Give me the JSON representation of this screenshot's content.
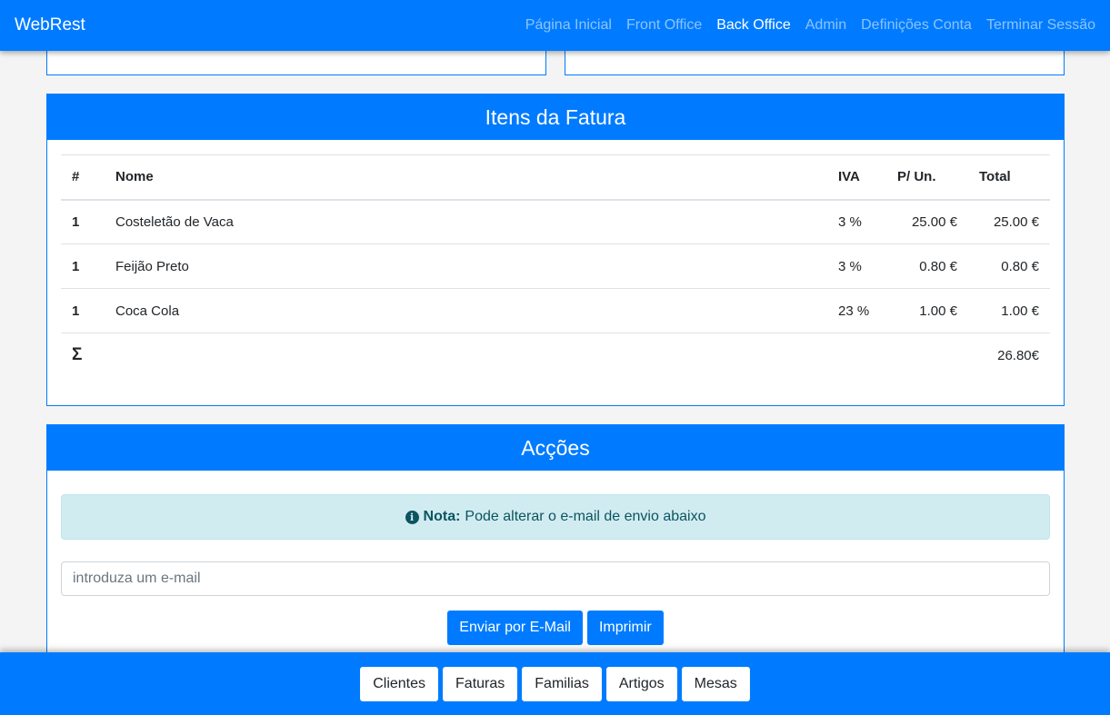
{
  "navbar": {
    "brand": "WebRest",
    "links": [
      {
        "label": "Página Inicial"
      },
      {
        "label": "Front Office"
      },
      {
        "label": "Back Office"
      },
      {
        "label": "Admin"
      },
      {
        "label": "Definições Conta"
      },
      {
        "label": "Terminar Sessão"
      }
    ],
    "active_link": "Back Office"
  },
  "items_card": {
    "title": "Itens da Fatura",
    "headers": {
      "num": "#",
      "name": "Nome",
      "iva": "IVA",
      "unit_price": "P/ Un.",
      "total": "Total"
    },
    "rows": [
      {
        "qty": "1",
        "name": "Costeletão de Vaca",
        "iva": "3 %",
        "unit_price": "25.00 €",
        "total": "25.00 €"
      },
      {
        "qty": "1",
        "name": "Feijão Preto",
        "iva": "3 %",
        "unit_price": "0.80 €",
        "total": "0.80 €"
      },
      {
        "qty": "1",
        "name": "Coca Cola",
        "iva": "23 %",
        "unit_price": "1.00 €",
        "total": "1.00 €"
      }
    ],
    "sum_symbol": "Σ",
    "grand_total": "26.80€"
  },
  "actions_card": {
    "title": "Acções",
    "note_label": "Nota:",
    "note_text": "Pode alterar o e-mail de envio abaixo",
    "email_placeholder": "introduza um e-mail",
    "send_label": "Enviar por E-Mail",
    "print_label": "Imprimir"
  },
  "footer": {
    "buttons": [
      {
        "label": "Clientes"
      },
      {
        "label": "Faturas"
      },
      {
        "label": "Familias"
      },
      {
        "label": "Artigos"
      },
      {
        "label": "Mesas"
      }
    ]
  },
  "colors": {
    "primary": "#007bff",
    "info_bg": "#d1ecf1",
    "info_text": "#0c5460"
  }
}
